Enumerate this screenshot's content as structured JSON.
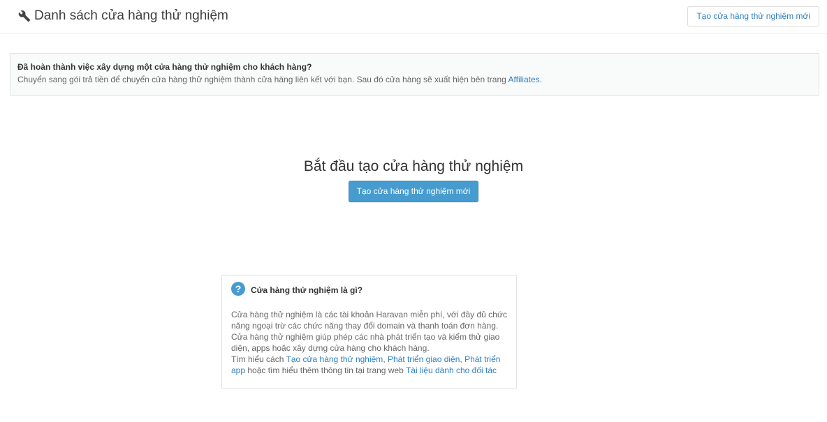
{
  "header": {
    "title": "Danh sách cửa hàng thử nghiệm",
    "icon": "wrench-icon",
    "create_button_label": "Tạo cửa hàng thử nghiệm mới"
  },
  "notice": {
    "title": "Đã hoàn thành việc xây dựng một cửa hàng thử nghiệm cho khách hàng?",
    "text": "Chuyển sang gói trả tiền để chuyển cửa hàng thử nghiệm thành cửa hàng liên kết với bạn. Sau đó cửa hàng sẽ xuất hiện bên trang ",
    "link_label": "Affiliates",
    "text_end": "."
  },
  "empty_state": {
    "heading": "Bắt đầu tạo cửa hàng thử nghiệm",
    "button_label": "Tạo cửa hàng thử nghiệm mới"
  },
  "help": {
    "icon": "question-icon",
    "icon_glyph": "?",
    "title": "Cửa hàng thử nghiệm là gì?",
    "body": "Cửa hàng thử nghiệm là các tài khoản Haravan miễn phí, với đầy đủ chức năng ngoại trừ các chức năng thay đổi domain và thanh toán đơn hàng. Cửa hàng thử nghiệm giúp phép các nhà phát triển tạo và kiểm thử giao diện, apps hoặc xây dựng cửa hàng cho khách hàng.",
    "learn_prefix": "Tìm hiểu cách ",
    "link_create": "Tạo cửa hàng thử nghiệm",
    "sep1": ", ",
    "link_theme": "Phát triển giao diện",
    "sep2": ", ",
    "link_app": "Phát triển app",
    "learn_middle": " hoặc tìm hiểu thêm thông tin tại trang web ",
    "link_docs": "Tài liệu dành cho đối tác"
  },
  "colors": {
    "accent": "#479ccf",
    "link": "#2f7fc1"
  }
}
